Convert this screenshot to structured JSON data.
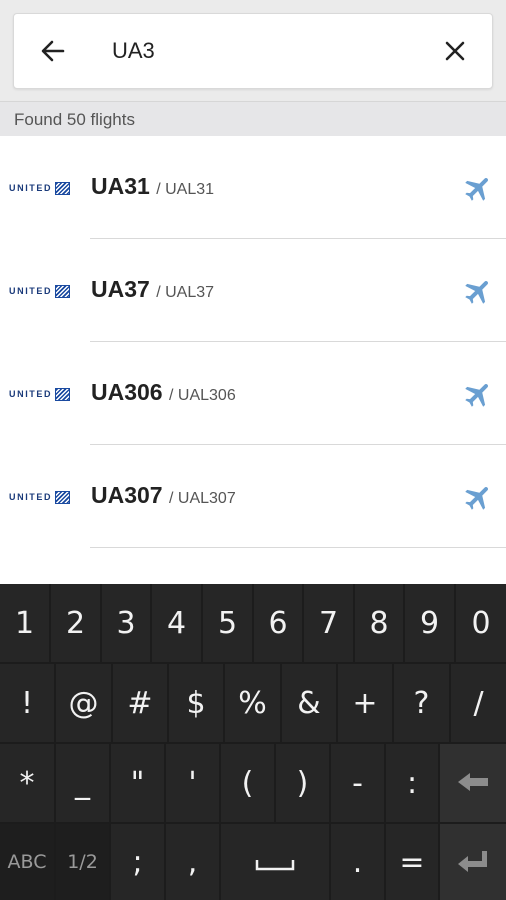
{
  "search": {
    "query": "UA3",
    "back_icon": "arrow-left-icon",
    "clear_icon": "close-icon"
  },
  "results": {
    "count_text": "Found 50 flights",
    "flights": [
      {
        "code": "UA31",
        "icao": "/ UAL31",
        "airline_logo": "UNITED"
      },
      {
        "code": "UA37",
        "icao": "/ UAL37",
        "airline_logo": "UNITED"
      },
      {
        "code": "UA306",
        "icao": "/ UAL306",
        "airline_logo": "UNITED"
      },
      {
        "code": "UA307",
        "icao": "/ UAL307",
        "airline_logo": "UNITED"
      }
    ],
    "plane_icon_color": "#6a9fd1"
  },
  "keyboard": {
    "row1": [
      "1",
      "2",
      "3",
      "4",
      "5",
      "6",
      "7",
      "8",
      "9",
      "0"
    ],
    "row2": [
      "!",
      "@",
      "#",
      "$",
      "%",
      "&",
      "+",
      "?",
      "/"
    ],
    "row3": [
      "*",
      "_",
      "\"",
      "'",
      "(",
      ")",
      "-",
      ":"
    ],
    "row4": {
      "abc": "ABC",
      "page": "1/2",
      "k1": ";",
      "k2": ",",
      "k3": ".",
      "k4": "="
    },
    "backspace_icon": "backspace-icon",
    "enter_icon": "enter-icon",
    "space_icon": "space-icon"
  }
}
